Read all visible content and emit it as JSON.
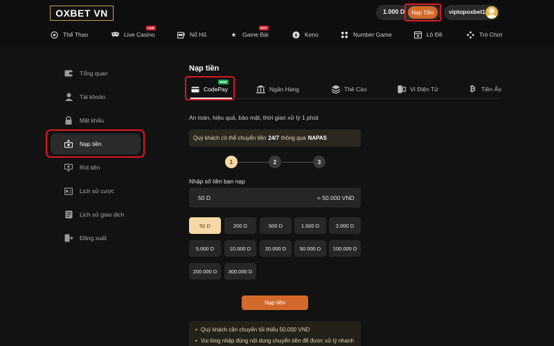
{
  "header": {
    "logo": "OXBET VN",
    "balance": "1.000 D",
    "deposit_label": "Nạp Tiền",
    "username": "viptopoxbet1"
  },
  "nav": [
    {
      "label": "Thể Thao",
      "icon": "soccer-ball-icon"
    },
    {
      "label": "Live Casino",
      "icon": "mask-icon",
      "badge": "LIVE"
    },
    {
      "label": "Nổ Hũ",
      "icon": "slot-machine-icon"
    },
    {
      "label": "Game Bài",
      "icon": "spade-icon",
      "badge": "HOT"
    },
    {
      "label": "Keno",
      "icon": "keno-ball-icon"
    },
    {
      "label": "Number Game",
      "icon": "number-game-icon"
    },
    {
      "label": "Lô Đề",
      "icon": "lottery-icon"
    },
    {
      "label": "Trò Chơi",
      "icon": "gamepad-icon"
    }
  ],
  "sidebar": {
    "items": [
      {
        "label": "Tổng quan",
        "icon": "wallet-icon"
      },
      {
        "label": "Tài khoản",
        "icon": "user-icon"
      },
      {
        "label": "Mật khẩu",
        "icon": "lock-icon"
      },
      {
        "label": "Nạp tiền",
        "icon": "deposit-icon",
        "active": true
      },
      {
        "label": "Rút tiền",
        "icon": "withdraw-icon"
      },
      {
        "label": "Lịch sử cược",
        "icon": "bet-history-icon"
      },
      {
        "label": "Lịch sử giao dịch",
        "icon": "transaction-history-icon"
      },
      {
        "label": "Đăng xuất",
        "icon": "logout-icon"
      }
    ]
  },
  "main": {
    "title": "Nạp tiền",
    "tabs": [
      {
        "label": "CodePay",
        "icon": "card-icon",
        "badge": "NEW",
        "active": true
      },
      {
        "label": "Ngân Hàng",
        "icon": "bank-icon"
      },
      {
        "label": "Thẻ Cào",
        "icon": "scratch-card-icon"
      },
      {
        "label": "Ví Điện Tử",
        "icon": "e-wallet-icon"
      },
      {
        "label": "Tiền Ảo",
        "icon": "bitcoin-icon"
      }
    ],
    "subtitle": "An toàn, hiệu quả, bảo mật, thời gian xử lý 1 phút",
    "notice_pre": "Quý khách có thể chuyển tiền",
    "notice_bold1": "24/7",
    "notice_mid": "thông qua",
    "notice_bold2": "NAPAS",
    "steps": [
      "1",
      "2",
      "3"
    ],
    "amount_label": "Nhập số tiền bạn nạp",
    "amount_value": "50 D",
    "amount_converted": "= 50.000 VND",
    "amounts": [
      "50 D",
      "200 D",
      "500 D",
      "1.000 D",
      "2.000 D",
      "5.000 D",
      "10.000 D",
      "20.000 D",
      "50.000 D",
      "100.000 D",
      "200.000 D",
      "300.000 D"
    ],
    "selected_amount": "50 D",
    "submit_label": "Nạp tiền",
    "info": [
      "Quý khách cần chuyển tối thiểu 50.000 VND",
      "Vui lòng nhập đúng nội dung chuyển tiền để được xử lý nhanh"
    ]
  },
  "colors": {
    "accent": "#d2692a",
    "highlight": "#e0171f",
    "selected_chip": "#f6d9a6"
  }
}
